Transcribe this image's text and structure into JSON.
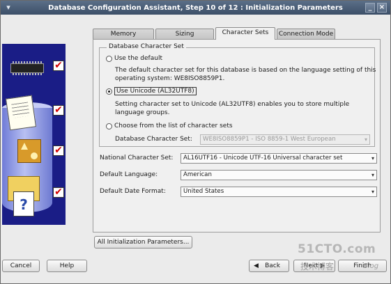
{
  "window": {
    "title": "Database Configuration Assistant, Step 10 of 12 : Initialization Parameters"
  },
  "tabs": [
    {
      "label": "Memory",
      "active": false
    },
    {
      "label": "Sizing",
      "active": false
    },
    {
      "label": "Character Sets",
      "active": true
    },
    {
      "label": "Connection Mode",
      "active": false
    }
  ],
  "charset_group": {
    "legend": "Database Character Set",
    "use_default": {
      "label": "Use the default",
      "desc_line1": "The default character set for this database is based on the language setting of this",
      "desc_line2": "operating system: WE8ISO8859P1."
    },
    "use_unicode": {
      "label": "Use Unicode (AL32UTF8)",
      "selected": true,
      "desc_line1": "Setting character set to Unicode (AL32UTF8) enables you to store multiple",
      "desc_line2": "language groups."
    },
    "choose_list": {
      "label": "Choose from the list of character sets",
      "field_label": "Database Character Set:",
      "field_value": "WE8ISO8859P1 - ISO 8859-1 West European"
    }
  },
  "national_charset": {
    "label": "National Character Set:",
    "value": "AL16UTF16 - Unicode UTF-16 Universal character set"
  },
  "default_language": {
    "label": "Default Language:",
    "value": "American"
  },
  "default_date_format": {
    "label": "Default Date Format:",
    "value": "United States"
  },
  "buttons": {
    "all_params": "All Initialization Parameters...",
    "cancel": "Cancel",
    "help": "Help",
    "back": "Back",
    "next": "Next",
    "finish": "Finish"
  },
  "watermark": {
    "line1": "51CTO.com",
    "line2": "技术博客",
    "line3": "Blog"
  },
  "colors": {
    "titlebar": "#4a5d77",
    "left_panel": "#1a1d86",
    "check": "#d10000"
  }
}
